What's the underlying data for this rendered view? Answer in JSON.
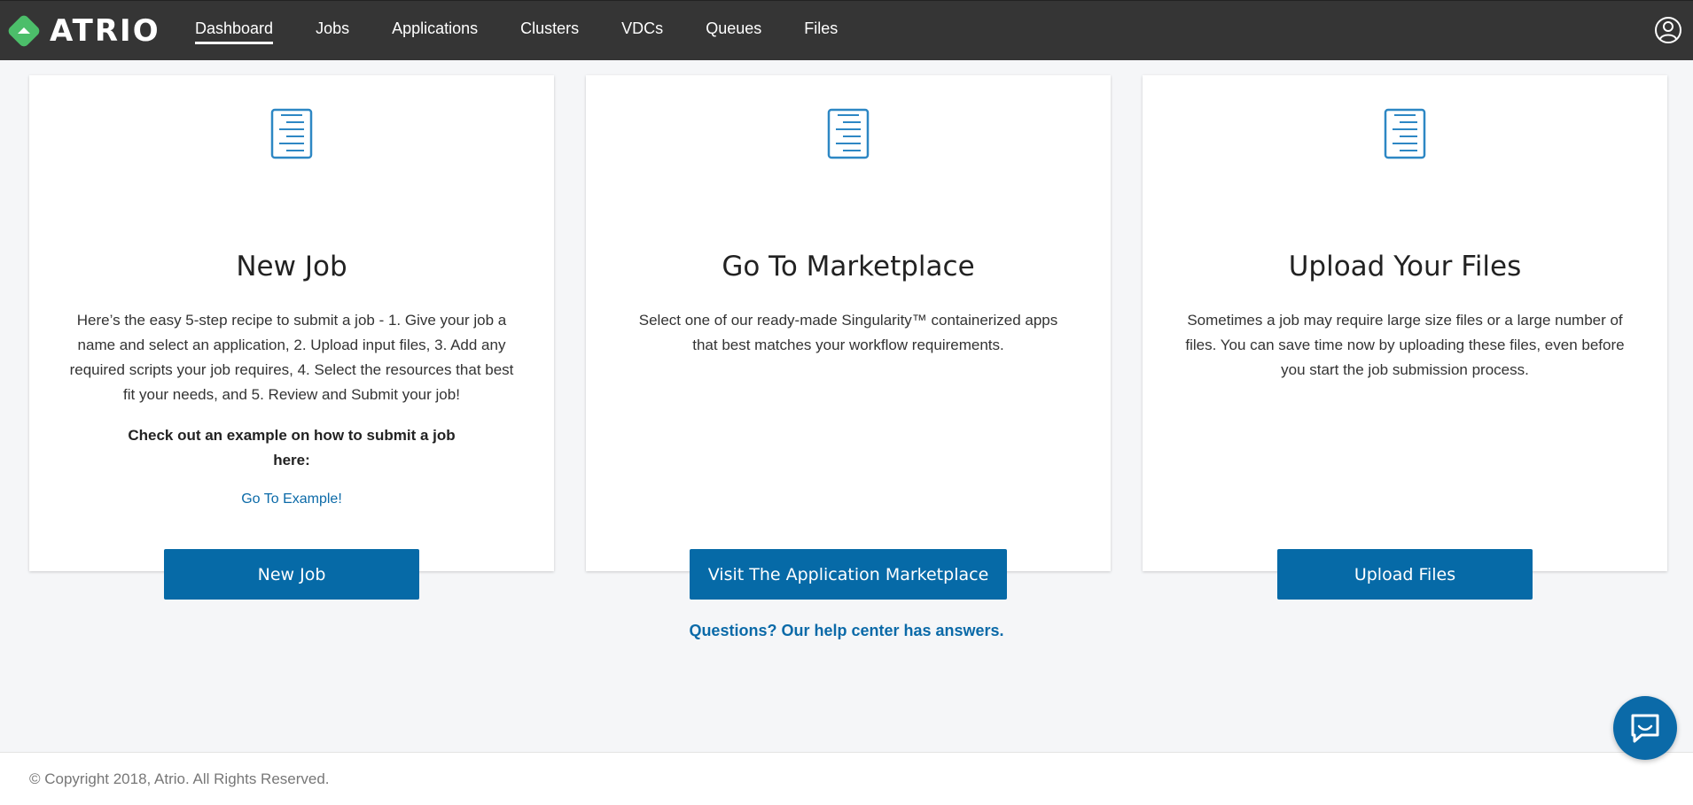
{
  "brand": {
    "name": "ATRIO",
    "logo_icon": "diamond-logo-icon",
    "accent": "#4cbe6a"
  },
  "nav": {
    "items": [
      {
        "label": "Dashboard",
        "active": true
      },
      {
        "label": "Jobs",
        "active": false
      },
      {
        "label": "Applications",
        "active": false
      },
      {
        "label": "Clusters",
        "active": false
      },
      {
        "label": "VDCs",
        "active": false
      },
      {
        "label": "Queues",
        "active": false
      },
      {
        "label": "Files",
        "active": false
      }
    ],
    "user_icon": "user-circle-icon"
  },
  "cards": [
    {
      "icon": "document-icon",
      "title": "New Job",
      "description": "Here’s the easy 5-step recipe to submit a job - 1. Give your job a name and select an application, 2. Upload input files, 3. Add any required scripts your job requires, 4. Select the resources that best fit your needs, and 5. Review and Submit your job!",
      "example_text": "Check out an example on how to submit a job here:",
      "example_link": "Go To Example!",
      "button": "New Job"
    },
    {
      "icon": "document-icon",
      "title": "Go To Marketplace",
      "description": "Select one of our ready-made Singularity™ containerized apps that best matches your workflow requirements.",
      "button": "Visit The Application Marketplace"
    },
    {
      "icon": "document-icon",
      "title": "Upload Your Files",
      "description": "Sometimes a job may require large size files or a large number of files. You can save time now by uploading these files, even before you start the job submission process.",
      "button": "Upload Files"
    }
  ],
  "help": {
    "link": "Questions? Our help center has answers."
  },
  "footer": {
    "copyright": "© Copyright 2018, Atrio. All Rights Reserved."
  },
  "chat": {
    "icon": "chat-icon"
  },
  "colors": {
    "navbar": "#353535",
    "button": "#066aa7",
    "link": "#0b6aa8",
    "background": "#f5f6f8"
  }
}
